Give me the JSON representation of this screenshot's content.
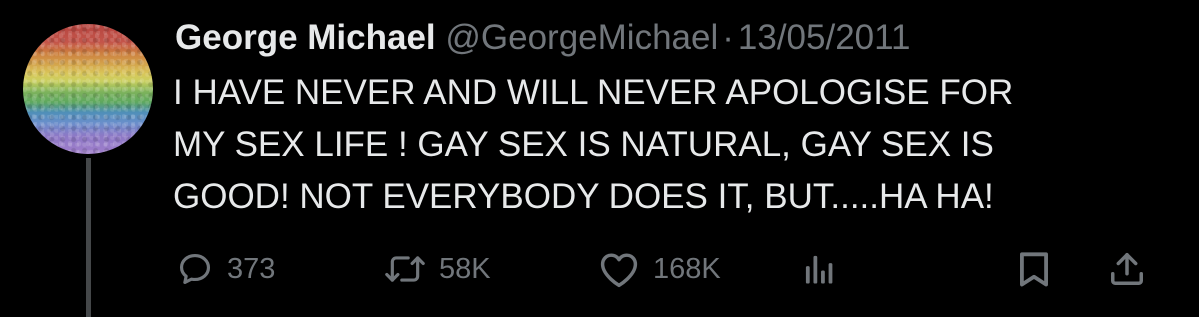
{
  "tweet": {
    "display_name": "George Michael",
    "handle": "@GeorgeMichael",
    "separator": "·",
    "date": "13/05/2011",
    "text": "I HAVE NEVER AND WILL NEVER APOLOGISE FOR\nMY SEX LIFE ! GAY SEX IS NATURAL, GAY SEX IS\nGOOD! NOT EVERYBODY DOES IT, BUT.....HA HA!"
  },
  "actions": {
    "replies": "373",
    "retweets": "58K",
    "likes": "168K"
  },
  "icons": {
    "reply": "reply-bubble-icon",
    "retweet": "retweet-arrows-icon",
    "like": "heart-icon",
    "views": "bar-chart-icon",
    "bookmark": "bookmark-icon",
    "share": "share-upload-icon"
  },
  "colors": {
    "background": "#000000",
    "text_primary": "#e7e9ea",
    "text_secondary": "#71767b",
    "thread_line": "#444749"
  }
}
